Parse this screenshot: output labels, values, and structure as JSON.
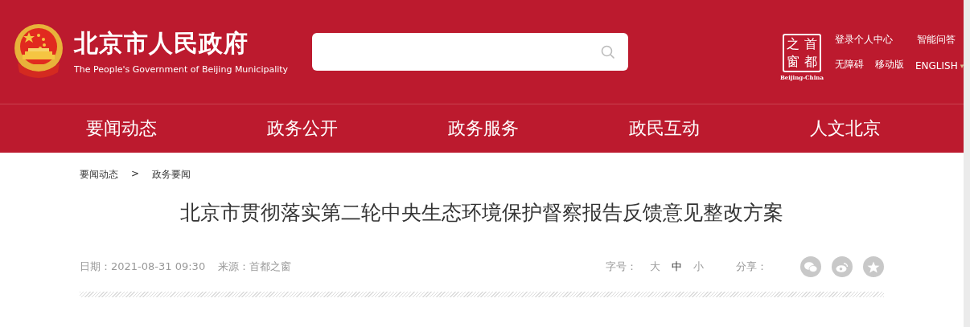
{
  "header": {
    "title": "北京市人民政府",
    "subtitle": "The People's Government of Beijing Municipality",
    "logo": {
      "characters": [
        "之",
        "首",
        "窗",
        "都"
      ],
      "caption": "Beijing-China"
    },
    "links_top": [
      "登录个人中心",
      "智能问答"
    ],
    "links_bottom": [
      "无障碍",
      "移动版"
    ],
    "language": {
      "label": "ENGLISH",
      "caret": "▾"
    }
  },
  "nav": {
    "items": [
      "要闻动态",
      "政务公开",
      "政务服务",
      "政民互动",
      "人文北京"
    ]
  },
  "breadcrumb": {
    "items": [
      "要闻动态",
      "政务要闻"
    ],
    "separator": ">"
  },
  "article": {
    "title": "北京市贯彻落实第二轮中央生态环境保护督察报告反馈意见整改方案",
    "date": "日期：2021-08-31 09:30",
    "source": "来源：首都之窗",
    "font_size": {
      "label": "字号：",
      "options": [
        {
          "label": "大",
          "selected": false
        },
        {
          "label": "中",
          "selected": true
        },
        {
          "label": "小",
          "selected": false
        }
      ]
    },
    "share": {
      "label": "分享："
    }
  }
}
